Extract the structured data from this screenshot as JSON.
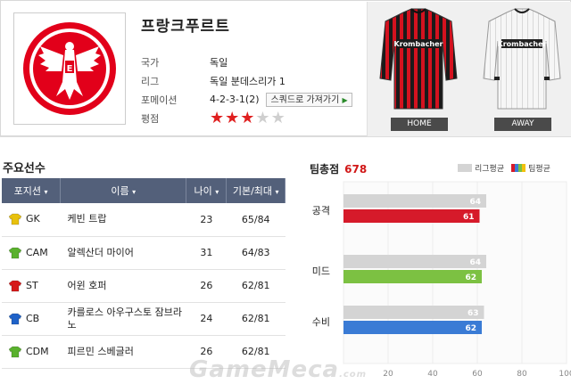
{
  "team": {
    "name": "프랑크푸르트",
    "info": [
      {
        "key": "국가",
        "value": "독일"
      },
      {
        "key": "리그",
        "value": "독일 분데스리가 1"
      },
      {
        "key": "포메이션",
        "value": "4-2-3-1(2)"
      },
      {
        "key": "평점",
        "value": ""
      }
    ],
    "squad_button": "스쿼드로 가져가기",
    "rating_stars": 3,
    "rating_max": 5,
    "kit_sponsor": "Krombacher",
    "kits": [
      {
        "label": "HOME"
      },
      {
        "label": "AWAY"
      }
    ]
  },
  "players": {
    "title": "주요선수",
    "headers": [
      "포지션",
      "이름",
      "나이",
      "기본/최대"
    ],
    "rows": [
      {
        "pos": "GK",
        "color": "#e8c10e",
        "name": "케빈 트랍",
        "age": "23",
        "rating": "65/84"
      },
      {
        "pos": "CAM",
        "color": "#5ab12e",
        "name": "알렉산더 마이어",
        "age": "31",
        "rating": "64/83"
      },
      {
        "pos": "ST",
        "color": "#d61a1a",
        "name": "어윈 호퍼",
        "age": "26",
        "rating": "62/81"
      },
      {
        "pos": "CB",
        "color": "#1f62c8",
        "name": "카를로스 아우구스토 잠브라노",
        "age": "24",
        "rating": "62/81"
      },
      {
        "pos": "CDM",
        "color": "#5ab12e",
        "name": "피르민 스베글러",
        "age": "26",
        "rating": "62/81"
      }
    ]
  },
  "team_score": {
    "title": "팀총점",
    "value": "678",
    "legend_league": "리그평균",
    "legend_team": "팀평균"
  },
  "chart_data": {
    "type": "bar",
    "categories": [
      "공격",
      "미드",
      "수비"
    ],
    "series": [
      {
        "name": "리그평균",
        "values": [
          64,
          64,
          63
        ]
      },
      {
        "name": "팀평균",
        "values": [
          61,
          62,
          62
        ]
      }
    ],
    "team_colors": [
      "#d61a2a",
      "#7cc142",
      "#3a7bd5"
    ],
    "league_color": "#d4d4d4",
    "xticks": [
      "20",
      "40",
      "60",
      "80",
      "100"
    ],
    "xlim": [
      0,
      100
    ]
  },
  "watermark": {
    "main": "GameMeca",
    "suffix": ".com"
  }
}
